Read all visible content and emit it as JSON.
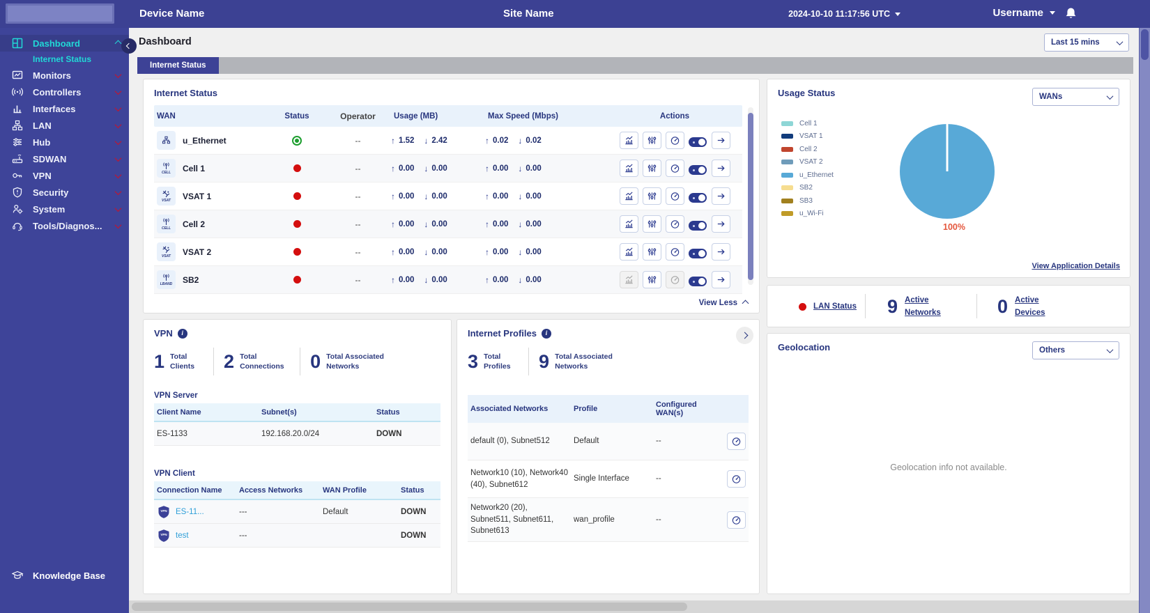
{
  "colors": {
    "topbar_bg": "#3c4193",
    "sidebar_bg": "#3e4499",
    "accent_cyan": "#21d8d6",
    "navy": "#27357e",
    "link_blue": "#2f9fd8",
    "down_red": "#cf1124",
    "status_red": "#d40e0e",
    "status_green": "#1d9e2f",
    "active_tab_bg": "#3d4296"
  },
  "glyphs": {
    "up": "↑",
    "down": "↓"
  },
  "topbar": {
    "device_name": "Device Name",
    "site_name": "Site Name",
    "timestamp": "2024-10-10 11:17:56 UTC",
    "username": "Username"
  },
  "page": {
    "title": "Dashboard",
    "time_range": "Last 15 mins",
    "active_tab": "Internet Status"
  },
  "sidebar": {
    "items": [
      {
        "label": "Dashboard",
        "active": true,
        "expanded": true
      },
      {
        "label": "Monitors"
      },
      {
        "label": "Controllers"
      },
      {
        "label": "Interfaces"
      },
      {
        "label": "LAN"
      },
      {
        "label": "Hub"
      },
      {
        "label": "SDWAN"
      },
      {
        "label": "VPN"
      },
      {
        "label": "Security"
      },
      {
        "label": "System"
      },
      {
        "label": "Tools/Diagnos..."
      }
    ],
    "subitem": {
      "label": "Internet Status",
      "active": true
    },
    "footer": {
      "label": "Knowledge Base"
    }
  },
  "internet_status": {
    "title": "Internet Status",
    "columns": [
      "WAN",
      "Status",
      "Operator",
      "Usage (MB)",
      "Max Speed (Mbps)",
      "Actions"
    ],
    "rows": [
      {
        "wan": "u_Ethernet",
        "type": "ethernet",
        "badge": "",
        "status": "up",
        "operator": "--",
        "usage_up": "1.52",
        "usage_down": "2.42",
        "speed_up": "0.02",
        "speed_down": "0.02"
      },
      {
        "wan": "Cell 1",
        "type": "cell",
        "badge": "CELL",
        "status": "down",
        "operator": "--",
        "usage_up": "0.00",
        "usage_down": "0.00",
        "speed_up": "0.00",
        "speed_down": "0.00"
      },
      {
        "wan": "VSAT 1",
        "type": "vsat",
        "badge": "VSAT",
        "status": "down",
        "operator": "--",
        "usage_up": "0.00",
        "usage_down": "0.00",
        "speed_up": "0.00",
        "speed_down": "0.00"
      },
      {
        "wan": "Cell 2",
        "type": "cell",
        "badge": "CELL",
        "status": "down",
        "operator": "--",
        "usage_up": "0.00",
        "usage_down": "0.00",
        "speed_up": "0.00",
        "speed_down": "0.00"
      },
      {
        "wan": "VSAT 2",
        "type": "vsat",
        "badge": "VSAT",
        "status": "down",
        "operator": "--",
        "usage_up": "0.00",
        "usage_down": "0.00",
        "speed_up": "0.00",
        "speed_down": "0.00"
      },
      {
        "wan": "SB2",
        "type": "lband",
        "badge": "LBAND",
        "status": "down",
        "operator": "--",
        "usage_up": "0.00",
        "usage_down": "0.00",
        "speed_up": "0.00",
        "speed_down": "0.00",
        "partially_disabled": true
      }
    ],
    "view_less_label": "View Less"
  },
  "usage_status": {
    "title": "Usage Status",
    "filter_value": "WANs",
    "details_link": "View Application Details",
    "chart_data": {
      "type": "pie",
      "labels": [
        "Cell 1",
        "VSAT 1",
        "Cell 2",
        "VSAT 2",
        "u_Ethernet",
        "SB2",
        "SB3",
        "u_Wi-Fi"
      ],
      "values": [
        0,
        0,
        0,
        0,
        100,
        0,
        0,
        0
      ],
      "unit": "percent",
      "colors": [
        "#8ed6d6",
        "#123c7c",
        "#c0452e",
        "#6f9cba",
        "#58a9d7",
        "#f6dd90",
        "#a1801f",
        "#c09b28"
      ],
      "annotations": [
        "100%"
      ],
      "legend_position": "left"
    }
  },
  "lan_summary": {
    "status": {
      "label": "LAN Status",
      "state": "down"
    },
    "networks": {
      "value": "9",
      "label": "Active Networks"
    },
    "devices": {
      "value": "0",
      "label": "Active Devices"
    }
  },
  "vpn": {
    "title": "VPN",
    "stats": [
      {
        "value": "1",
        "label": "Total Clients"
      },
      {
        "value": "2",
        "label": "Total Connections"
      },
      {
        "value": "0",
        "label": "Total Associated Networks"
      }
    ],
    "server": {
      "heading": "VPN Server",
      "columns": [
        "Client Name",
        "Subnet(s)",
        "Status"
      ],
      "rows": [
        {
          "client_name": "ES-1133",
          "subnets": "192.168.20.0/24",
          "status": "DOWN"
        }
      ]
    },
    "client": {
      "heading": "VPN Client",
      "columns": [
        "Connection Name",
        "Access Networks",
        "WAN Profile",
        "Status"
      ],
      "rows": [
        {
          "connection_name": "ES-11...",
          "access_networks": "---",
          "wan_profile": "Default",
          "status": "DOWN"
        },
        {
          "connection_name": "test",
          "access_networks": "---",
          "wan_profile": "",
          "status": "DOWN"
        }
      ]
    }
  },
  "internet_profiles": {
    "title": "Internet Profiles",
    "stats": [
      {
        "value": "3",
        "label": "Total Profiles"
      },
      {
        "value": "9",
        "label": "Total Associated Networks"
      }
    ],
    "columns": [
      "Associated Networks",
      "Profile",
      "Configured WAN(s)"
    ],
    "rows": [
      {
        "networks": "default (0), Subnet512",
        "profile": "Default",
        "wans": "--"
      },
      {
        "networks": "Network10 (10), Network40 (40), Subnet612",
        "profile": "Single Interface",
        "wans": "--"
      },
      {
        "networks": "Network20 (20), Subnet511, Subnet611, Subnet613",
        "profile": "wan_profile",
        "wans": "--"
      }
    ]
  },
  "geolocation": {
    "title": "Geolocation",
    "filter_value": "Others",
    "message": "Geolocation info not available."
  }
}
